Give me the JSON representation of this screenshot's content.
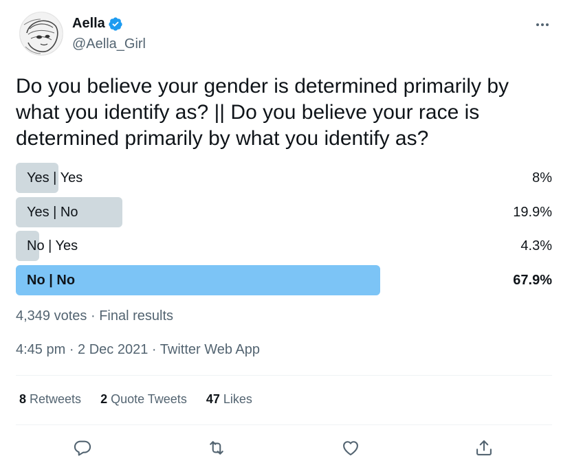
{
  "author": {
    "display_name": "Aella",
    "handle": "@Aella_Girl",
    "verified": true
  },
  "tweet": {
    "text": "Do you believe your gender is determined primarily by what you identify as? || Do you believe your race is determined primarily by what you identify as?"
  },
  "poll": {
    "options": [
      {
        "label": "Yes | Yes",
        "percent_text": "8%",
        "percent": 8,
        "winner": false
      },
      {
        "label": "Yes | No",
        "percent_text": "19.9%",
        "percent": 19.9,
        "winner": false
      },
      {
        "label": "No | Yes",
        "percent_text": "4.3%",
        "percent": 4.3,
        "winner": false
      },
      {
        "label": "No | No",
        "percent_text": "67.9%",
        "percent": 67.9,
        "winner": true
      }
    ],
    "votes": "4,349 votes",
    "separator": " · ",
    "status": "Final results"
  },
  "timestamp": {
    "time": "4:45 pm",
    "date": "2 Dec 2021",
    "source": "Twitter Web App",
    "separator": " · "
  },
  "stats": {
    "retweets_count": "8",
    "retweets_label": " Retweets",
    "quotes_count": "2",
    "quotes_label": " Quote Tweets",
    "likes_count": "47",
    "likes_label": " Likes"
  },
  "icons": {
    "more": "more-horizontal-icon",
    "reply": "reply-icon",
    "retweet": "retweet-icon",
    "like": "heart-icon",
    "share": "share-icon",
    "verified": "verified-badge-icon"
  },
  "colors": {
    "accent": "#1d9bf0",
    "poll_winner": "#7cc4f6",
    "poll_other": "#cfd9de",
    "secondary_text": "#536471",
    "primary_text": "#0f1419",
    "divider": "#eff3f4"
  }
}
